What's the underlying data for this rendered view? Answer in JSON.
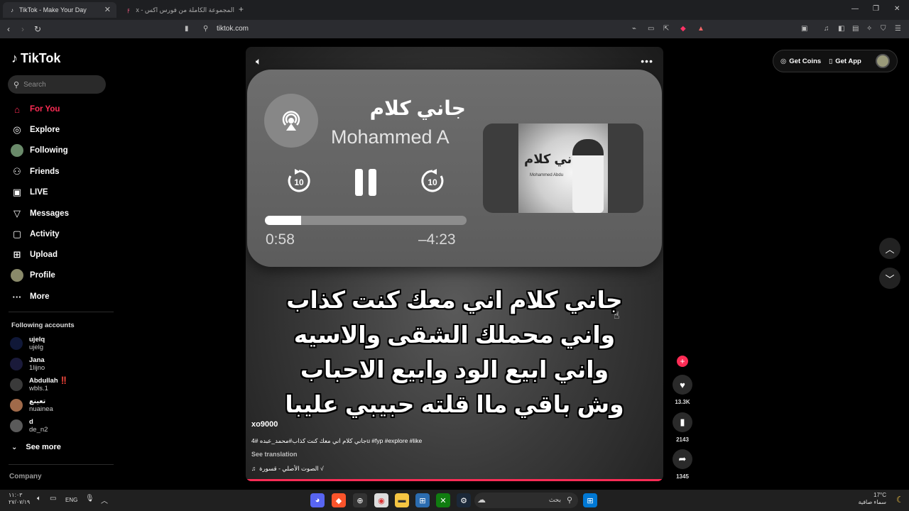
{
  "browser": {
    "tabs": [
      {
        "title": "TikTok - Make Your Day",
        "active": true
      },
      {
        "title": "المجموعة الكاملة من فورس اكس - recex",
        "active": false
      }
    ],
    "url": "tiktok.com"
  },
  "sidebar": {
    "logo": "TikTok",
    "search_placeholder": "Search",
    "nav": [
      {
        "label": "For You",
        "icon": "home-icon",
        "active": true
      },
      {
        "label": "Explore",
        "icon": "compass-icon"
      },
      {
        "label": "Following",
        "icon": "following-avatar-icon"
      },
      {
        "label": "Friends",
        "icon": "friends-icon"
      },
      {
        "label": "LIVE",
        "icon": "live-icon"
      },
      {
        "label": "Messages",
        "icon": "messages-icon"
      },
      {
        "label": "Activity",
        "icon": "activity-icon"
      },
      {
        "label": "Upload",
        "icon": "upload-icon"
      },
      {
        "label": "Profile",
        "icon": "profile-avatar-icon"
      },
      {
        "label": "More",
        "icon": "more-dots-icon"
      }
    ],
    "following_title": "Following accounts",
    "accounts": [
      {
        "name": "ujelq",
        "username": "ujelg"
      },
      {
        "name": "Jana",
        "username": "1lijno"
      },
      {
        "name": "Abdullah ‼️",
        "username": "wbls.1"
      },
      {
        "name": "تعينع",
        "username": "nuainea"
      },
      {
        "name": "d",
        "username": "de_n2"
      }
    ],
    "see_more": "See more",
    "company": "Company"
  },
  "topbar": {
    "get_coins": "Get Coins",
    "get_app": "Get App"
  },
  "video": {
    "player": {
      "song_title": "جاني كلام",
      "artist": "Mohammed A",
      "elapsed": "0:58",
      "remaining": "–4:23",
      "progress": 0.18,
      "skip_back": "10",
      "skip_forward": "10",
      "album_title": "جاني كلام",
      "album_artist": "Mohammed Abdu"
    },
    "lyrics": [
      "جاني كلام اني معك كنت كذاب",
      "واني محملك الشقى والاسيه",
      "واني ابيع الود وابيع الاحباب",
      "وش باقي ماا قلته حبيبي عليبا"
    ],
    "username": "xo9000",
    "description": "جاني كلام اني معك كنت كذاب#محمد_عبده #4u #fyp #explore #like",
    "see_translation": "See translation",
    "music": "الصوت الأصلي - قسورة √"
  },
  "actions": {
    "likes": "13.3K",
    "saves": "2143",
    "shares": "1345"
  },
  "taskbar": {
    "time": "١١:٠٣",
    "date": "٢٧/٠٧/١٩",
    "lang": "ENG",
    "search_placeholder": "بحث",
    "weather_temp": "17°C",
    "weather_desc": "سماء صافية"
  },
  "colors": {
    "accent": "#fe2c55"
  }
}
